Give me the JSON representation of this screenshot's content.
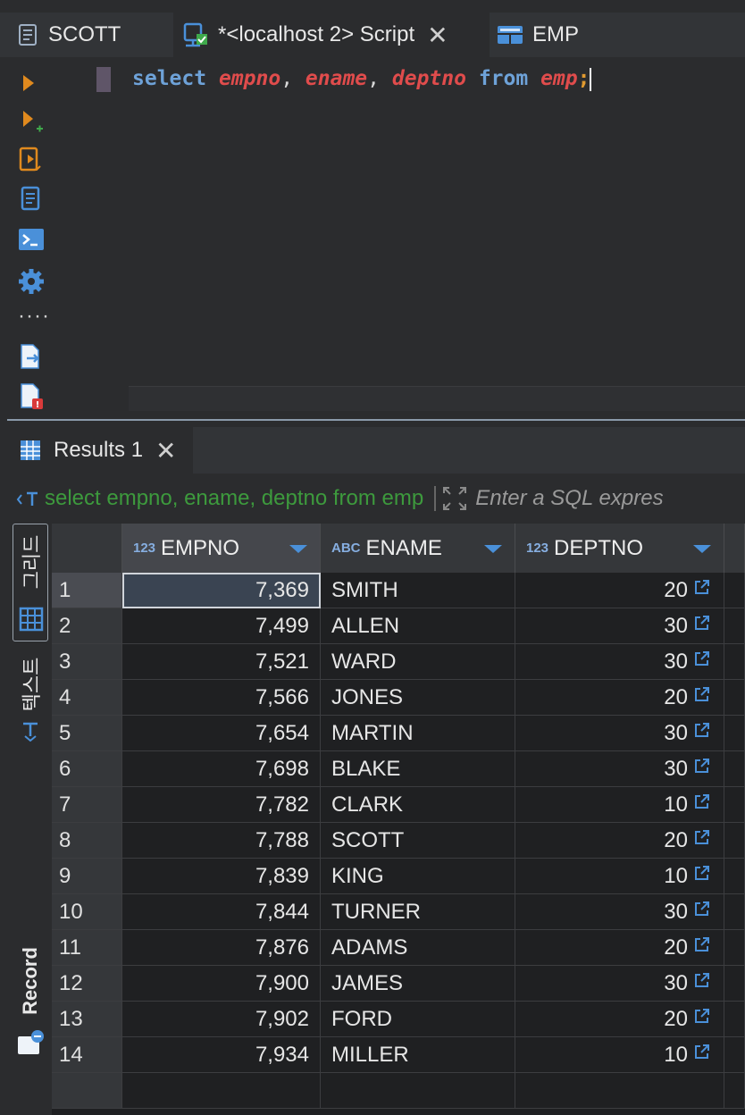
{
  "tabs": [
    {
      "label": "SCOTT",
      "icon": "script-file-icon"
    },
    {
      "label": "*<localhost 2> Script",
      "icon": "sql-editor-icon"
    },
    {
      "label": "EMP",
      "icon": "table-icon"
    }
  ],
  "editor": {
    "code_tokens": [
      {
        "text": "select",
        "type": "keyword"
      },
      {
        "text": " ",
        "type": "space"
      },
      {
        "text": "empno",
        "type": "identifier"
      },
      {
        "text": ", ",
        "type": "punct"
      },
      {
        "text": "ename",
        "type": "identifier"
      },
      {
        "text": ", ",
        "type": "punct"
      },
      {
        "text": "deptno",
        "type": "identifier"
      },
      {
        "text": " ",
        "type": "space"
      },
      {
        "text": "from",
        "type": "keyword"
      },
      {
        "text": " ",
        "type": "space"
      },
      {
        "text": "emp",
        "type": "identifier"
      },
      {
        "text": ";",
        "type": "semicolon"
      }
    ],
    "toolbar_icons": [
      "execute-statement-icon",
      "execute-new-tab-icon",
      "execute-script-icon",
      "explain-plan-icon",
      "terminal-icon",
      "settings-gear-icon",
      "more-icon",
      "export-icon",
      "error-log-icon"
    ]
  },
  "results": {
    "tab_label": "Results 1",
    "filter_sql": "select empno, ename, deptno from emp",
    "filter_placeholder": "Enter a SQL expres",
    "side_labels": {
      "grid": "그리드",
      "text": "텍스트",
      "record": "Record"
    },
    "columns": [
      {
        "type": "123",
        "name": "EMPNO"
      },
      {
        "type": "ABC",
        "name": "ENAME"
      },
      {
        "type": "123",
        "name": "DEPTNO"
      }
    ],
    "rows": [
      {
        "n": "1",
        "empno": "7,369",
        "ename": "SMITH",
        "deptno": "20"
      },
      {
        "n": "2",
        "empno": "7,499",
        "ename": "ALLEN",
        "deptno": "30"
      },
      {
        "n": "3",
        "empno": "7,521",
        "ename": "WARD",
        "deptno": "30"
      },
      {
        "n": "4",
        "empno": "7,566",
        "ename": "JONES",
        "deptno": "20"
      },
      {
        "n": "5",
        "empno": "7,654",
        "ename": "MARTIN",
        "deptno": "30"
      },
      {
        "n": "6",
        "empno": "7,698",
        "ename": "BLAKE",
        "deptno": "30"
      },
      {
        "n": "7",
        "empno": "7,782",
        "ename": "CLARK",
        "deptno": "10"
      },
      {
        "n": "8",
        "empno": "7,788",
        "ename": "SCOTT",
        "deptno": "20"
      },
      {
        "n": "9",
        "empno": "7,839",
        "ename": "KING",
        "deptno": "10"
      },
      {
        "n": "10",
        "empno": "7,844",
        "ename": "TURNER",
        "deptno": "30"
      },
      {
        "n": "11",
        "empno": "7,876",
        "ename": "ADAMS",
        "deptno": "20"
      },
      {
        "n": "12",
        "empno": "7,900",
        "ename": "JAMES",
        "deptno": "30"
      },
      {
        "n": "13",
        "empno": "7,902",
        "ename": "FORD",
        "deptno": "20"
      },
      {
        "n": "14",
        "empno": "7,934",
        "ename": "MILLER",
        "deptno": "10"
      }
    ],
    "selected_row": 1
  }
}
